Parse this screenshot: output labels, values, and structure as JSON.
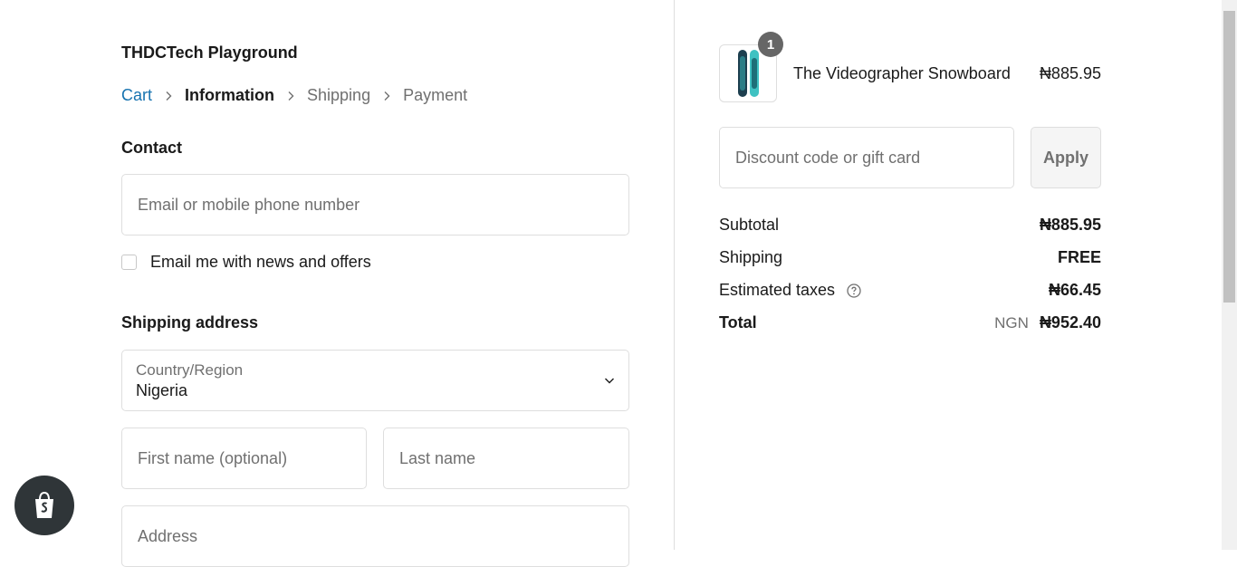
{
  "store": {
    "name": "THDCTech Playground"
  },
  "breadcrumb": [
    {
      "label": "Cart",
      "state": "link"
    },
    {
      "label": "Information",
      "state": "active"
    },
    {
      "label": "Shipping",
      "state": "inactive"
    },
    {
      "label": "Payment",
      "state": "inactive"
    }
  ],
  "contact": {
    "title": "Contact",
    "email_placeholder": "Email or mobile phone number",
    "newsletter_label": "Email me with news and offers",
    "newsletter_checked": false
  },
  "shipping": {
    "title": "Shipping address",
    "country_label": "Country/Region",
    "country_value": "Nigeria",
    "first_name_placeholder": "First name (optional)",
    "last_name_placeholder": "Last name",
    "address_placeholder": "Address"
  },
  "order": {
    "product": {
      "name": "The Videographer Snowboard",
      "price": "₦885.95",
      "quantity": "1"
    },
    "discount": {
      "placeholder": "Discount code or gift card",
      "apply_label": "Apply"
    },
    "subtotal": {
      "label": "Subtotal",
      "value": "₦885.95"
    },
    "shipping": {
      "label": "Shipping",
      "value": "FREE"
    },
    "taxes": {
      "label": "Estimated taxes",
      "value": "₦66.45"
    },
    "total": {
      "label": "Total",
      "currency": "NGN",
      "value": "₦952.40"
    }
  },
  "icons": {
    "breadcrumb_separator": "chevron-right-icon",
    "select": "chevron-down-icon",
    "help": "question-circle-icon",
    "shop": "shopify-bag-icon"
  },
  "colors": {
    "link": "#1773b0",
    "muted": "#707070",
    "border": "#dedede",
    "badge": "#666666"
  }
}
